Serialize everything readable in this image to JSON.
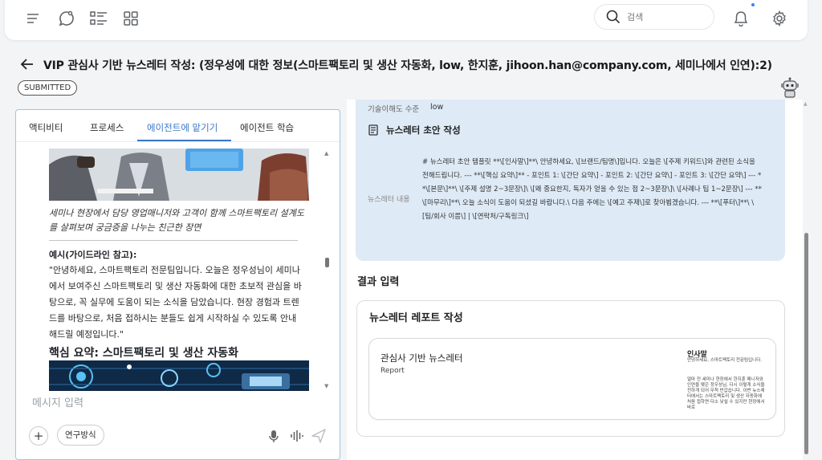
{
  "topbar": {
    "icons": [
      "menu-icon",
      "chat-bubble-icon",
      "checklist-icon",
      "grid-icon"
    ],
    "search_placeholder": "검색"
  },
  "header": {
    "title": "VIP 관심사 기반 뉴스레터 작성: (정우성에 대한 정보(스마트팩토리 및 생산 자동화, low, 한지훈, jihoon.han@company.com, 세미나에서 인연):2)",
    "status": "SUBMITTED"
  },
  "left_panel": {
    "tabs": [
      {
        "label": "액티비티",
        "active": false
      },
      {
        "label": "프로세스",
        "active": false
      },
      {
        "label": "에이전트에 맡기기",
        "active": true
      },
      {
        "label": "에이전트 학습",
        "active": false
      }
    ],
    "chat": {
      "caption": "세미나 현장에서 담당 영업매니저와 고객이 함께 스마트팩토리 설계도를 살펴보며 궁금증을 나누는 친근한 장면",
      "example_label": "예시(가이드라인 참고):",
      "example_text": "\"안녕하세요, 스마트팩토리 전문팀입니다. 오늘은 정우성님이 세미나에서 보여주신 스마트팩토리 및 생산 자동화에 대한 초보적 관심을 바탕으로, 꼭 실무에 도움이 되는 소식을 담았습니다. 현장 경험과 트렌드를 바탕으로, 처음 접하시는 분들도 쉽게 시작하실 수 있도록 안내해드릴 예정입니다.\"",
      "summary_heading": "핵심 요약: 스마트팩토리 및 생산 자동화"
    },
    "input_placeholder": "메시지 입력",
    "method_button": "연구방식"
  },
  "right_panel": {
    "tech_label": "기술이해도 수준",
    "tech_value": "low",
    "draft_title": "뉴스레터 초안 작성",
    "newsletter_label": "뉴스레터 내용",
    "newsletter_content": "# 뉴스레터 초안 템플릿 **\\[인사말\\]**\\ 안녕하세요, \\[브랜드/팀명\\]입니다. 오늘은 \\[주제 키워드\\]와 관련된 소식을 전해드립니다. --- **\\[핵심 요약\\]** - 포인트 1: \\[간단 요약\\] - 포인트 2: \\[간단 요약\\] - 포인트 3: \\[간단 요약\\] --- **\\[본문\\]**\\ \\[주제 설명 2~3문장\\]\\ \\[왜 중요한지, 독자가 얻을 수 있는 점 2~3문장\\]\\ \\[사례나 팁 1~2문장\\] --- **\\[마무리\\]**\\ 오늘 소식이 도움이 되셨길 바랍니다.\\ 다음 주에는 \\[예고 주제\\]로 찾아뵙겠습니다. --- **\\[푸터\\]**\\ \\[팀/회사 이름\\] | \\[연락처/구독링크\\]",
    "result_heading": "결과 입력",
    "report_card_title": "뉴스레터 레포트 작성",
    "report_item": {
      "title": "관심사 기반 뉴스레터",
      "subtitle": "Report",
      "thumb_heading": "인사말",
      "thumb_line1": "안녕하세요, 스마트팩토리 전문팀입니다.",
      "thumb_line2": "얼마 전 세미나 현장에서 한지훈 매니저와 인연을 맺은 정우성님, 다시 이렇게 소식을 전하게 되어 무척 반갑습니다. 이번 뉴스레터에서는 스마트팩토리 및 생산 자동화에 처음 접하면 다소 낯설 수 있지만 현장에서 바로"
    },
    "accent_color": "#3a77c9",
    "card_color": "#deeaf6"
  }
}
